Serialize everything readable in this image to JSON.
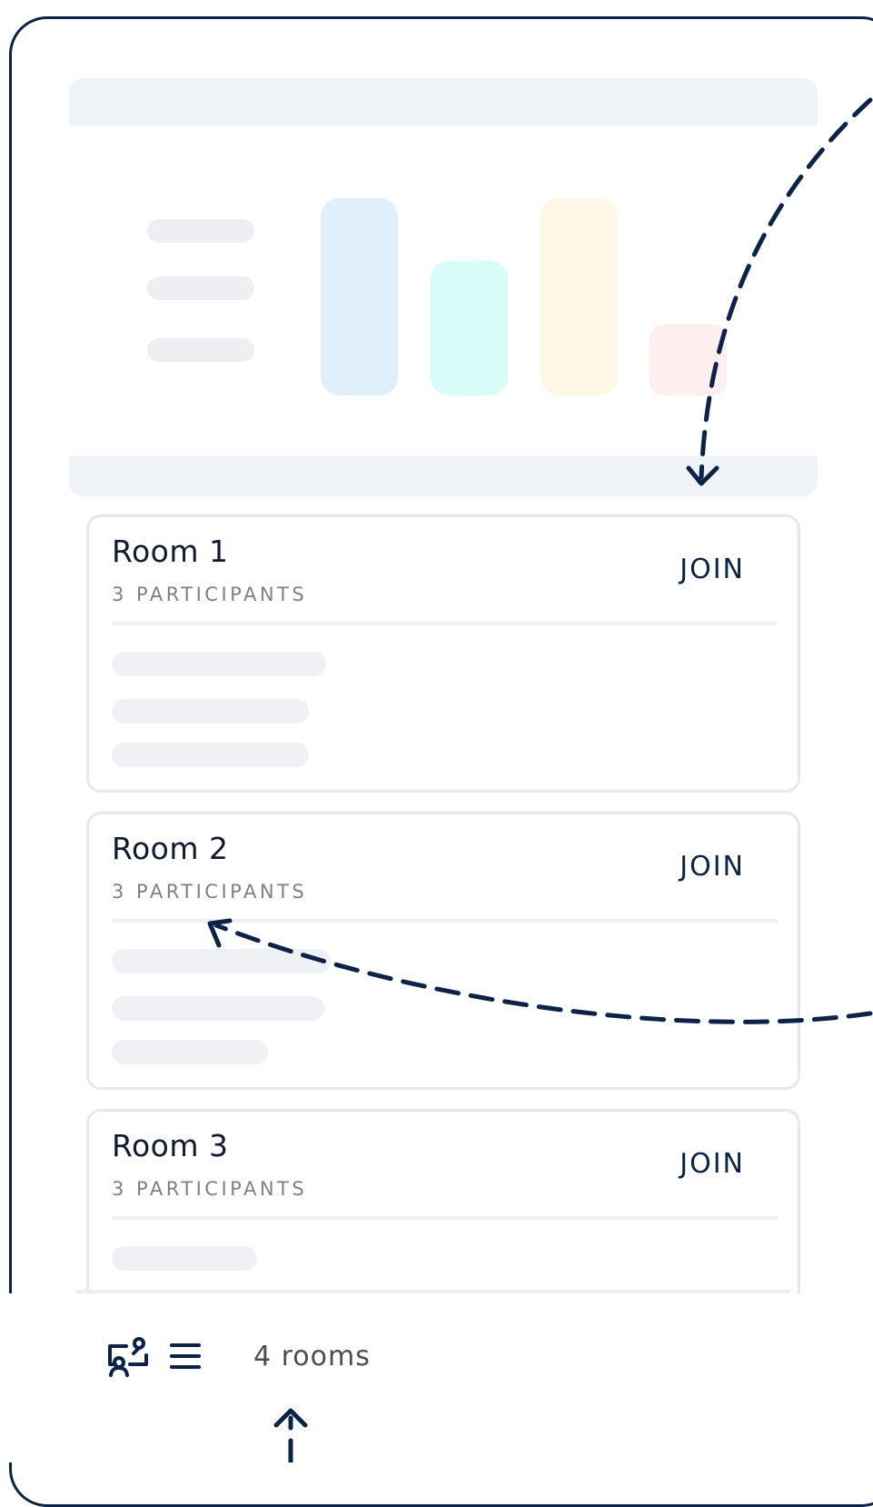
{
  "rooms": [
    {
      "title": "Room 1",
      "participants": "3 PARTICIPANTS",
      "join_label": "JOIN"
    },
    {
      "title": "Room 2",
      "participants": "3 PARTICIPANTS",
      "join_label": "JOIN"
    },
    {
      "title": "Room 3",
      "participants": "3 PARTICIPANTS",
      "join_label": "JOIN"
    }
  ],
  "footer": {
    "room_count": "4 rooms",
    "icons": [
      "presentation-icon",
      "menu-icon"
    ]
  },
  "colors": {
    "frame": "#0c2247",
    "bar_blue": "#dfeffc",
    "bar_teal": "#d8fcf8",
    "bar_yellow": "#fff7e6",
    "bar_pink": "#fdeef0"
  }
}
